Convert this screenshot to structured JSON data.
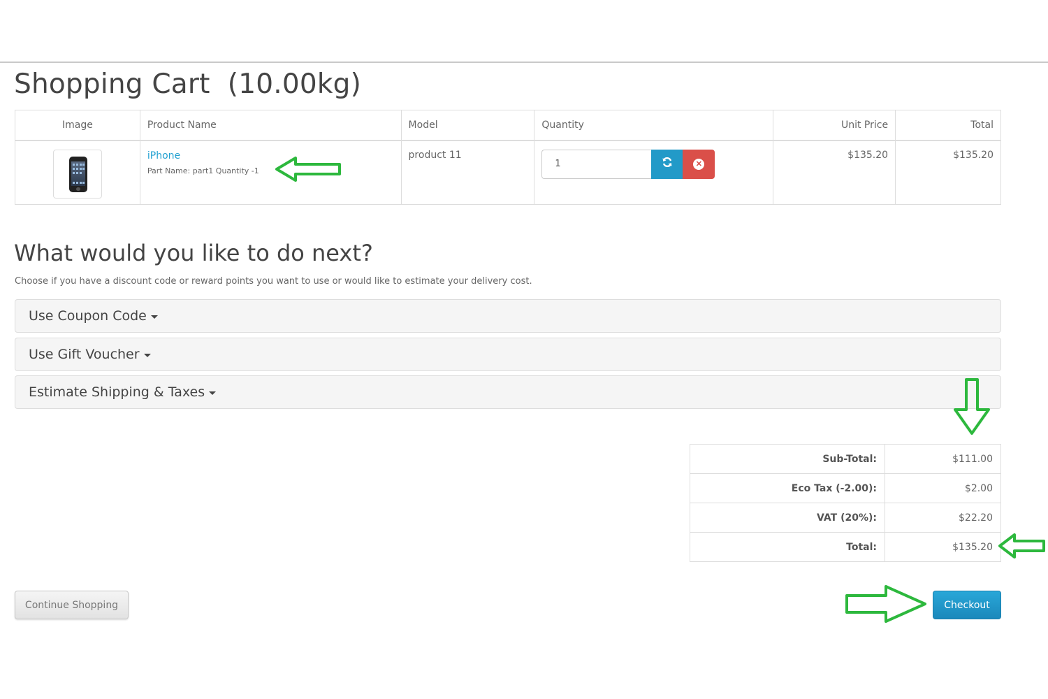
{
  "page_title": "Shopping Cart  (10.00kg)",
  "cart_table": {
    "headers": [
      "Image",
      "Product Name",
      "Model",
      "Quantity",
      "Unit Price",
      "Total"
    ],
    "rows": [
      {
        "image_icon": "iphone-product-image",
        "name": "iPhone",
        "option": "Part Name: part1 Quantity -1",
        "model": "product 11",
        "quantity": "1",
        "unit_price": "$135.20",
        "total": "$135.20"
      }
    ]
  },
  "next_section": {
    "heading": "What would you like to do next?",
    "description": "Choose if you have a discount code or reward points you want to use or would like to estimate your delivery cost.",
    "panels": [
      "Use Coupon Code",
      "Use Gift Voucher",
      "Estimate Shipping & Taxes"
    ]
  },
  "totals": [
    {
      "label": "Sub-Total:",
      "value": "$111.00"
    },
    {
      "label": "Eco Tax (-2.00):",
      "value": "$2.00"
    },
    {
      "label": "VAT (20%):",
      "value": "$22.20"
    },
    {
      "label": "Total:",
      "value": "$135.20"
    }
  ],
  "buttons": {
    "continue": "Continue Shopping",
    "checkout": "Checkout"
  },
  "icons": {
    "refresh": "refresh-icon",
    "remove": "remove-circle-icon",
    "caret": "caret-down-icon",
    "annotation": "green-arrow-icon"
  },
  "colors": {
    "link": "#23a1d1",
    "refresh_button": "#229ac8",
    "remove_button": "#da4f49",
    "checkout_button": "#1f95c9",
    "annotation_arrow": "#2db83d"
  }
}
